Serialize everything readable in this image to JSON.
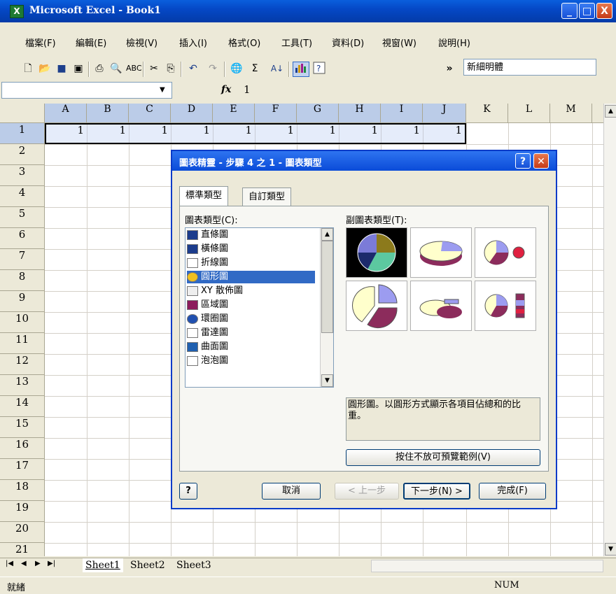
{
  "window": {
    "title": "Microsoft Excel - Book1",
    "app_icon": "excel-icon",
    "minimize": "_",
    "maximize": "□",
    "close": "X"
  },
  "menu": [
    "檔案(F)",
    "編輯(E)",
    "檢視(V)",
    "插入(I)",
    "格式(O)",
    "工具(T)",
    "資料(D)",
    "視窗(W)",
    "說明(H)"
  ],
  "toolbar": {
    "font": "新細明體",
    "more": "»",
    "icons": [
      "new-icon",
      "open-icon",
      "save-icon",
      "permission-icon",
      "print-icon",
      "print-preview-icon",
      "spelling-icon",
      "cut-icon",
      "copy-icon",
      "undo-icon",
      "redo-icon",
      "hyperlink-icon",
      "autosum-icon",
      "sort-ascending-icon",
      "chart-wizard-icon",
      "help-icon"
    ],
    "autosum": "Σ"
  },
  "formula_bar": {
    "name_box": "",
    "fx": "fx",
    "value": "1"
  },
  "columns": [
    "A",
    "B",
    "C",
    "D",
    "E",
    "F",
    "G",
    "H",
    "I",
    "J",
    "K",
    "L",
    "M"
  ],
  "rows": [
    "1",
    "2",
    "3",
    "4",
    "5",
    "6",
    "7",
    "8",
    "9",
    "10",
    "11",
    "12",
    "13",
    "14",
    "15",
    "16",
    "17",
    "18",
    "19",
    "20",
    "21"
  ],
  "row1_values": [
    "1",
    "1",
    "1",
    "1",
    "1",
    "1",
    "1",
    "1",
    "1",
    "1"
  ],
  "sheets": [
    "Sheet1",
    "Sheet2",
    "Sheet3"
  ],
  "status": {
    "left": "就緒",
    "num": "NUM"
  },
  "dialog": {
    "title": "圖表精靈 - 步驟 4 之 1 - 圖表類型",
    "tabs": [
      "標準類型",
      "自訂類型"
    ],
    "chart_type_label": "圖表類型(C):",
    "chart_types": [
      "直條圖",
      "橫條圖",
      "折線圖",
      "圓形圖",
      "XY 散佈圖",
      "區域圖",
      "環圈圖",
      "雷達圖",
      "曲面圖",
      "泡泡圖"
    ],
    "selected_type": "圓形圖",
    "subtype_label": "副圖表類型(T):",
    "description": "圓形圖。以圓形方式顯示各項目佔總和的比重。",
    "preview_button": "按住不放可預覽範例(V)",
    "help_button": "?",
    "cancel_button": "取消",
    "back_button": "< 上一步",
    "next_button": "下一步(N) >",
    "finish_button": "完成(F)"
  }
}
